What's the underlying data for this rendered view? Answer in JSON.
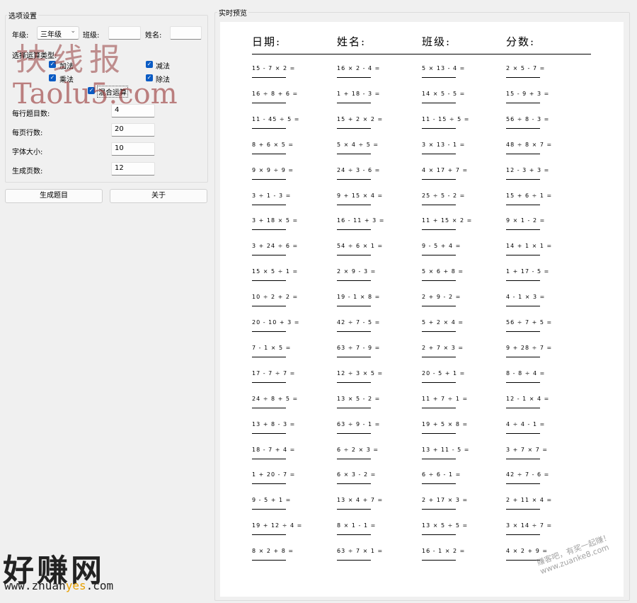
{
  "options": {
    "group_title": "选项设置",
    "grade_label": "年级:",
    "grade_value": "三年级",
    "class_label": "班级:",
    "name_label": "姓名:",
    "operation_type_label": "选择运算类型:",
    "checkboxes": {
      "add": "加法",
      "subtract": "减法",
      "multiply": "乘法",
      "divide": "除法",
      "mixed": "混合运算"
    },
    "per_row_label": "每行题目数:",
    "per_row_value": "4",
    "rows_per_page_label": "每页行数:",
    "rows_per_page_value": "20",
    "font_size_label": "字体大小:",
    "font_size_value": "10",
    "pages_label": "生成页数:",
    "pages_value": "12"
  },
  "buttons": {
    "generate": "生成题目",
    "about": "关于"
  },
  "preview": {
    "group_title": "实时预览",
    "headers": [
      "日期:",
      "姓名:",
      "班级:",
      "分数:"
    ],
    "columns": [
      [
        "15 - 7 × 2 =",
        "16 ÷ 8 + 6 =",
        "11 - 45 ÷ 5 =",
        "8 + 6 × 5 =",
        "9 × 9 ÷ 9 =",
        "3 ÷ 1 - 3 =",
        "3 + 18 × 5 =",
        "3 + 24 ÷ 6 =",
        "15 × 5 ÷ 1 =",
        "10 ÷ 2 + 2 =",
        "20 - 10 + 3 =",
        "7 - 1 × 5 =",
        "17 - 7 ÷ 7 =",
        "24 ÷ 8 + 5 =",
        "13 + 8 - 3 =",
        "18 - 7 + 4 =",
        "1 + 20 - 7 =",
        "9 - 5 + 1 =",
        "19 + 12 ÷ 4 =",
        "8 × 2 + 8 ="
      ],
      [
        "16 × 2 - 4 =",
        "1 + 18 - 3 =",
        "15 + 2 × 2 =",
        "5 × 4 ÷ 5 =",
        "24 ÷ 3 - 6 =",
        "9 + 15 × 4 =",
        "16 - 11 + 3 =",
        "54 ÷ 6 × 1 =",
        "2 × 9 - 3 =",
        "19 - 1 × 8 =",
        "42 ÷ 7 - 5 =",
        "63 ÷ 7 - 9 =",
        "12 ÷ 3 × 5 =",
        "13 × 5 - 2 =",
        "63 ÷ 9 - 1 =",
        "6 ÷ 2 × 3 =",
        "6 × 3 - 2 =",
        "13 × 4 + 7 =",
        "8 × 1 - 1 =",
        "63 ÷ 7 × 1 ="
      ],
      [
        "5 × 13 - 4 =",
        "14 × 5 - 5 =",
        "11 - 15 ÷ 5 =",
        "3 × 13 - 1 =",
        "4 × 17 + 7 =",
        "25 ÷ 5 - 2 =",
        "11 + 15 × 2 =",
        "9 - 5 + 4 =",
        "5 × 6 + 8 =",
        "2 + 9 - 2 =",
        "5 + 2 × 4 =",
        "2 + 7 × 3 =",
        "20 - 5 + 1 =",
        "11 + 7 ÷ 1 =",
        "19 + 5 × 8 =",
        "13 + 11 - 5 =",
        "6 ÷ 6 - 1 =",
        "2 + 17 × 3 =",
        "13 × 5 ÷ 5 =",
        "16 - 1 × 2 ="
      ],
      [
        "2 × 5 - 7 =",
        "15 - 9 + 3 =",
        "56 ÷ 8 - 3 =",
        "48 ÷ 8 × 7 =",
        "12 - 3 + 3 =",
        "15 + 6 ÷ 1 =",
        "9 × 1 - 2 =",
        "14 + 1 × 1 =",
        "1 + 17 - 5 =",
        "4 - 1 × 3 =",
        "56 ÷ 7 + 5 =",
        "9 + 28 ÷ 7 =",
        "8 - 8 ÷ 4 =",
        "12 - 1 × 4 =",
        "4 ÷ 4 - 1 =",
        "3 + 7 × 7 =",
        "42 ÷ 7 - 6 =",
        "2 + 11 × 4 =",
        "3 × 14 ÷ 7 =",
        "4 × 2 + 9 ="
      ]
    ]
  },
  "watermarks": {
    "top_cn": "扶线报",
    "top_en": "Taolu5.com",
    "bottom_cn": "好赚网",
    "bottom_url_1": "www.zhuan",
    "bottom_url_2": "yes",
    "bottom_url_3": ".com",
    "corner": "赚客吧，有奖一起赚！",
    "corner_url": "www.zuanke8.com"
  },
  "colors": {
    "checkbox": "#0a5bc4",
    "window_bg": "#f0f0f0"
  }
}
